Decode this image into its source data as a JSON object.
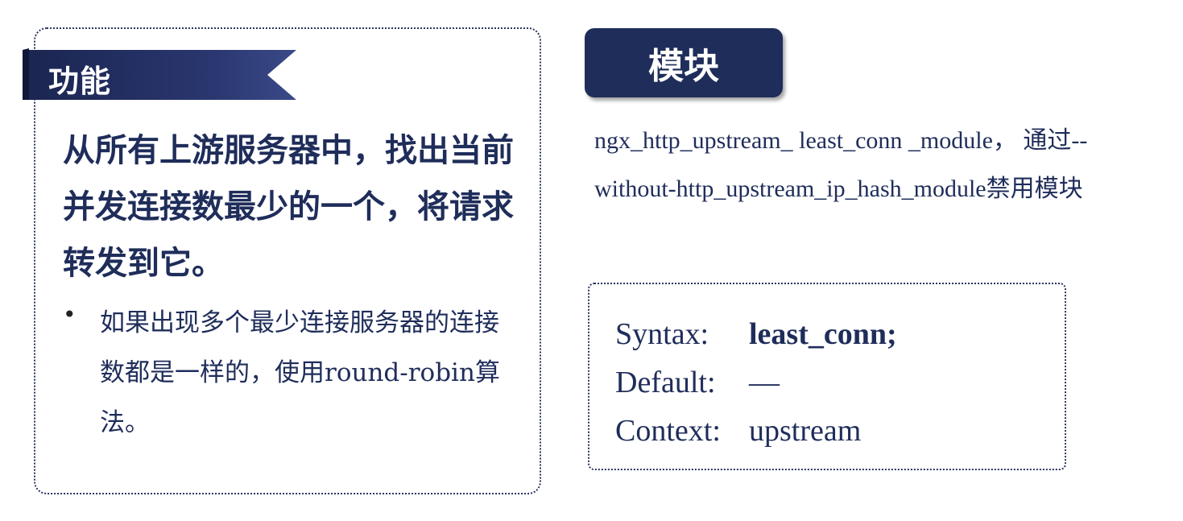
{
  "function_card": {
    "ribbon_label": "功能",
    "main_text": "从所有上游服务器中，找出当前并发连接数最少的一个，将请求转发到它。",
    "bullet": "如果出现多个最少连接服务器的连接数都是一样的，使用round-robin算法。"
  },
  "module_card": {
    "title": "模块",
    "description": "ngx_http_upstream_ least_conn _module， 通过--without-http_upstream_ip_hash_module禁用模块",
    "syntax": {
      "syntax_label": "Syntax:",
      "syntax_value": "least_conn;",
      "default_label": "Default:",
      "default_value": "—",
      "context_label": "Context:",
      "context_value": "upstream"
    }
  },
  "colors": {
    "navy": "#1f2d5a",
    "white": "#ffffff"
  }
}
